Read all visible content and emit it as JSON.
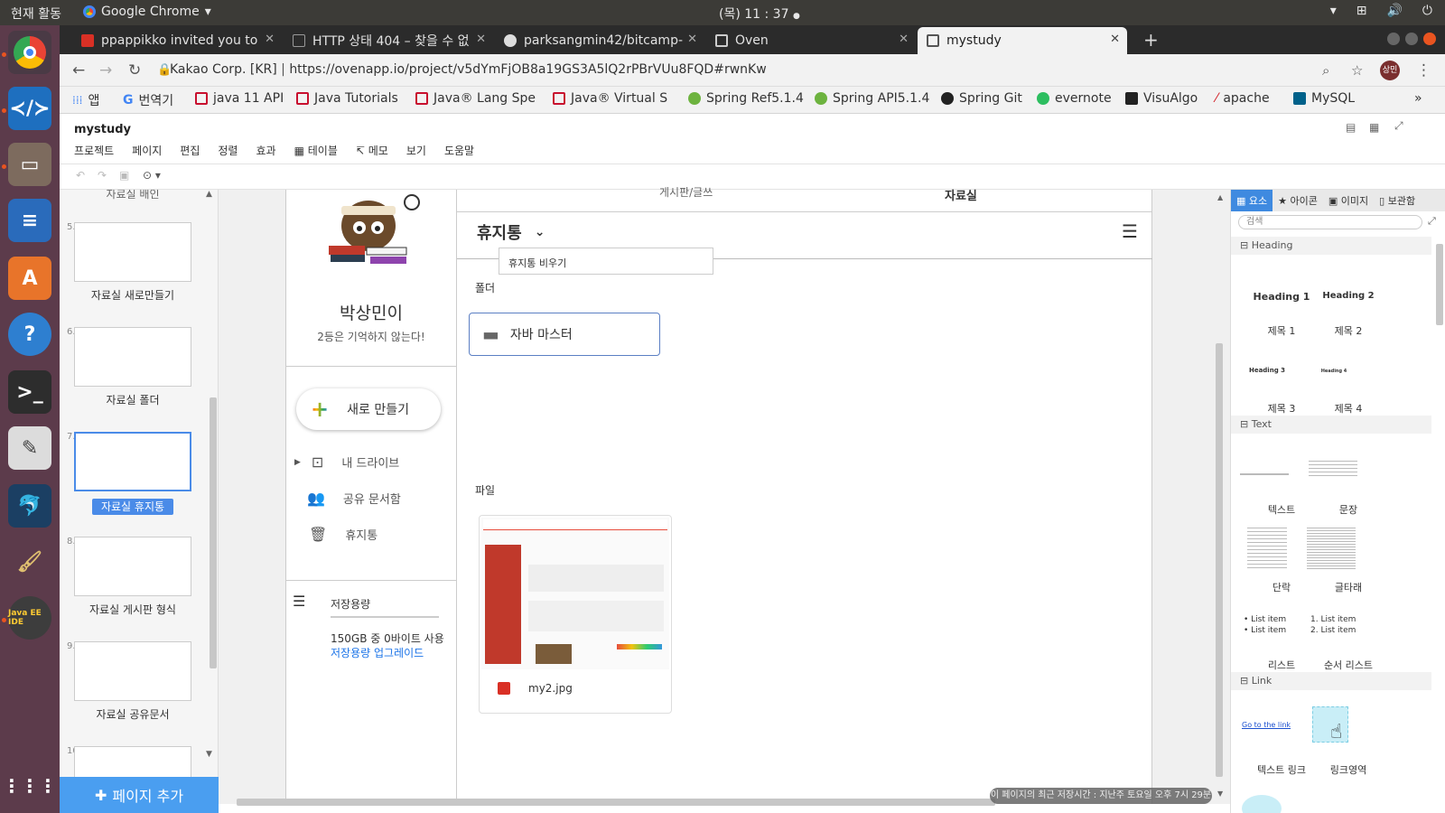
{
  "system": {
    "activities": "현재 활동",
    "app_name": "Google Chrome",
    "clock": "(목) 11 : 37"
  },
  "browser": {
    "tabs": [
      {
        "label": "ppappikko invited you to",
        "color": "#d93025"
      },
      {
        "label": "HTTP 상태 404 – 찾을 수 없",
        "color": "#666666"
      },
      {
        "label": "parksangmin42/bitcamp-",
        "color": "#444444"
      },
      {
        "label": "Oven",
        "color": "#555555"
      },
      {
        "label": "mystudy",
        "color": "#555555"
      }
    ],
    "url_host": "Kakao Corp. [KR]",
    "url": "https://ovenapp.io/project/v5dYmFjOB8a19GS3A5lQ2rPBrVUu8FQD#rwnKw",
    "profile": "상민",
    "bookmarks": [
      {
        "label": "앱",
        "color": "#4285f4"
      },
      {
        "label": "번역기",
        "color": "#4285f4"
      },
      {
        "label": "java 11 API",
        "color": "#c8102e"
      },
      {
        "label": "Java Tutorials",
        "color": "#c8102e"
      },
      {
        "label": "Java® Lang Spe",
        "color": "#c8102e"
      },
      {
        "label": "Java® Virtual S",
        "color": "#c8102e"
      },
      {
        "label": "Spring Ref5.1.4",
        "color": "#6db33f"
      },
      {
        "label": "Spring API5.1.4",
        "color": "#6db33f"
      },
      {
        "label": "Spring Git",
        "color": "#222222"
      },
      {
        "label": "evernote",
        "color": "#2dbe60"
      },
      {
        "label": "VisuAlgo",
        "color": "#222222"
      },
      {
        "label": "apache",
        "color": "#d22128"
      },
      {
        "label": "MySQL",
        "color": "#00618a"
      }
    ]
  },
  "app": {
    "title": "mystudy",
    "menu": [
      "프로젝트",
      "페이지",
      "편집",
      "정렬",
      "효과",
      "테이블",
      "메모",
      "보기",
      "도움말"
    ]
  },
  "pages": {
    "items": [
      {
        "num": "5.",
        "label": "자료실 새로만들기"
      },
      {
        "num": "6.",
        "label": "자료실 폴더"
      },
      {
        "num": "7.",
        "label": "자료실 휴지통"
      },
      {
        "num": "8.",
        "label": "자료실 게시판 형식"
      },
      {
        "num": "9.",
        "label": "자료실 공유문서"
      }
    ],
    "top_cut_label": "자료실 배인",
    "bottom_num": "10.",
    "add_page": "페이지 추가"
  },
  "design": {
    "user_name": "박상민이",
    "motto": "2등은 기억하지 않는다!",
    "new_button": "새로 만들기",
    "nav": [
      "내 드라이브",
      "공유 문서함",
      "휴지통"
    ],
    "storage_title": "저장용량",
    "storage_used": "150GB 중 0바이트 사용",
    "storage_upgrade": "저장용량 업그레이드",
    "tab_cut_left": "게시판/글쓰",
    "tab_cut_right": "자료실",
    "header_title": "휴지통",
    "dropdown_item": "휴지통 비우기",
    "folder_section": "폴더",
    "folder_name": "자바 마스터",
    "file_section": "파일",
    "file_name": "my2.jpg"
  },
  "panel": {
    "tabs": [
      "요소",
      "아이콘",
      "이미지",
      "보관함"
    ],
    "search_placeholder": "검색",
    "sections": {
      "heading": "Heading",
      "text": "Text",
      "link": "Link"
    },
    "heading_items": [
      {
        "preview": "Heading 1",
        "label": "제목 1"
      },
      {
        "preview": "Heading 2",
        "label": "제목 2"
      },
      {
        "preview": "Heading 3",
        "label": "제목 3"
      },
      {
        "preview": "Heading 4",
        "label": "제목 4"
      }
    ],
    "text_items": [
      {
        "label": "텍스트"
      },
      {
        "label": "문장"
      },
      {
        "label": "단락"
      },
      {
        "label": "글타래"
      },
      {
        "label": "리스트",
        "preview": "List item"
      },
      {
        "label": "순서 리스트",
        "preview": "List item"
      }
    ],
    "ordered_previews": [
      "1. List item",
      "2. List item"
    ],
    "link_items": [
      {
        "preview": "Go to the link",
        "label": "텍스트 링크"
      },
      {
        "label": "링크영역"
      }
    ]
  },
  "status": {
    "save_message": "이 페이지의 최근 저장시간 : 지난주 토요일 오후 7시 29분"
  }
}
